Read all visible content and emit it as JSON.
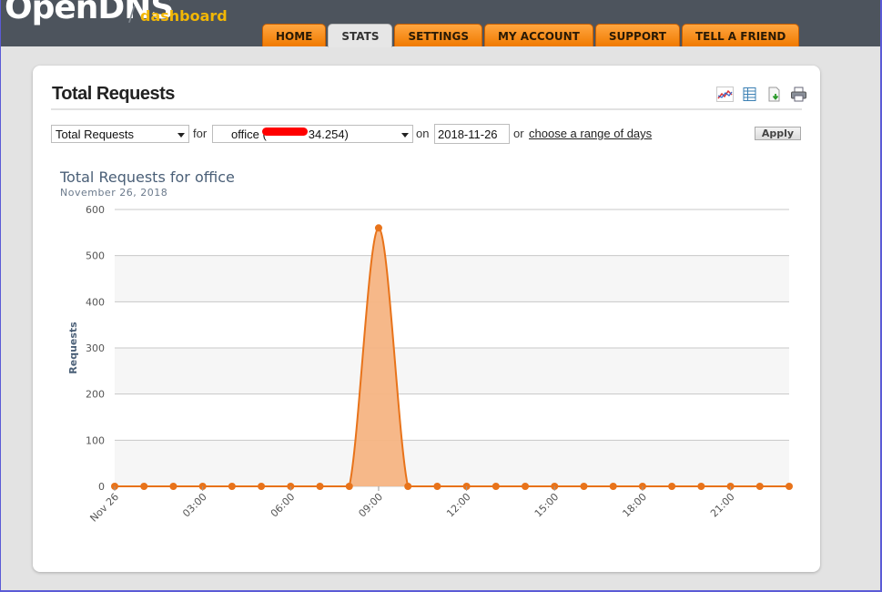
{
  "header": {
    "logo_text": "OpenDNS",
    "logo_sep": "/",
    "logo_sub": "dashboard"
  },
  "nav": {
    "tabs": [
      {
        "label": "HOME",
        "active": false
      },
      {
        "label": "STATS",
        "active": true
      },
      {
        "label": "SETTINGS",
        "active": false
      },
      {
        "label": "MY ACCOUNT",
        "active": false
      },
      {
        "label": "SUPPORT",
        "active": false
      },
      {
        "label": "TELL A FRIEND",
        "active": false
      }
    ]
  },
  "panel": {
    "title": "Total Requests",
    "icons": [
      "chart-view-icon",
      "table-view-icon",
      "download-icon",
      "print-icon"
    ]
  },
  "controls": {
    "report_select": "Total Requests",
    "for_text": "for",
    "network_select": "office (",
    "network_ip_suffix": "34.254)",
    "on_text": "on",
    "date_value": "2018-11-26",
    "or_text": "or",
    "range_link": "choose a range of days",
    "apply_label": "Apply"
  },
  "colors": {
    "accent": "#f07a00",
    "series_line": "#e8731a",
    "series_fill": "#f5b483",
    "title_color": "#4a5f77"
  },
  "chart_data": {
    "type": "area",
    "title": "Total Requests for office",
    "subtitle": "November 26, 2018",
    "xlabel": "",
    "ylabel": "Requests",
    "ylim": [
      0,
      600
    ],
    "yticks": [
      0,
      100,
      200,
      300,
      400,
      500,
      600
    ],
    "xtick_labels": [
      "Nov 26",
      "03:00",
      "06:00",
      "09:00",
      "12:00",
      "15:00",
      "18:00",
      "21:00"
    ],
    "xtick_hours": [
      0,
      3,
      6,
      9,
      12,
      15,
      18,
      21
    ],
    "grid": true,
    "series": [
      {
        "hours": [
          0,
          1,
          2,
          3,
          4,
          5,
          6,
          7,
          8,
          9,
          10,
          11,
          12,
          13,
          14,
          15,
          16,
          17,
          18,
          19,
          20,
          21,
          22,
          23
        ],
        "values": [
          0,
          0,
          0,
          0,
          0,
          0,
          0,
          0,
          0,
          560,
          0,
          0,
          0,
          0,
          0,
          0,
          0,
          0,
          0,
          0,
          0,
          0,
          0,
          0
        ]
      }
    ]
  }
}
